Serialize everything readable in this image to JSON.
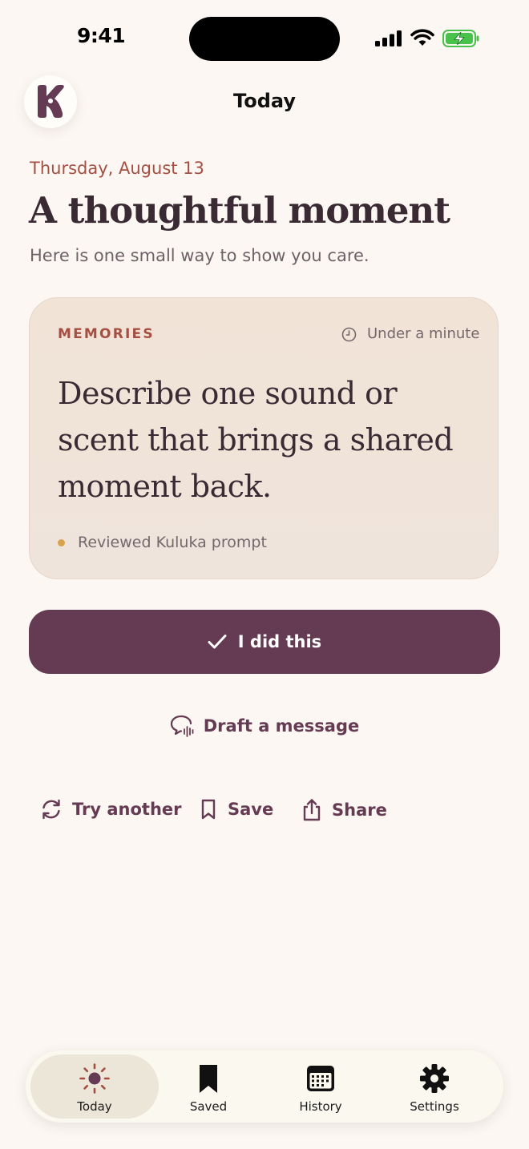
{
  "status_bar": {
    "time": "9:41"
  },
  "header": {
    "title": "Today",
    "logo_icon": "kuluka-logo"
  },
  "intro": {
    "date": "Thursday, August 13",
    "headline": "A thoughtful moment",
    "subtitle": "Here is one small way to show you care."
  },
  "card": {
    "category": "MEMORIES",
    "duration": "Under a minute",
    "prompt": "Describe one sound or scent that brings a shared moment back.",
    "source": "Reviewed Kuluka prompt"
  },
  "primary_button": {
    "label": "I did this"
  },
  "draft_button": {
    "label": "Draft a message"
  },
  "actions": [
    {
      "label": "Try another",
      "icon": "refresh-icon"
    },
    {
      "label": "Save",
      "icon": "bookmark-icon"
    },
    {
      "label": "Share",
      "icon": "share-icon"
    }
  ],
  "tabs": [
    {
      "label": "Today",
      "icon": "sun-icon",
      "selected": true
    },
    {
      "label": "Saved",
      "icon": "bookmark-filled-icon",
      "selected": false
    },
    {
      "label": "History",
      "icon": "calendar-icon",
      "selected": false
    },
    {
      "label": "Settings",
      "icon": "gear-icon",
      "selected": false
    }
  ],
  "colors": {
    "background": "#fcf7f2",
    "accent": "#643b52",
    "category": "#a54f42",
    "card": "#f1e3d6",
    "dot": "#d9a24a"
  }
}
